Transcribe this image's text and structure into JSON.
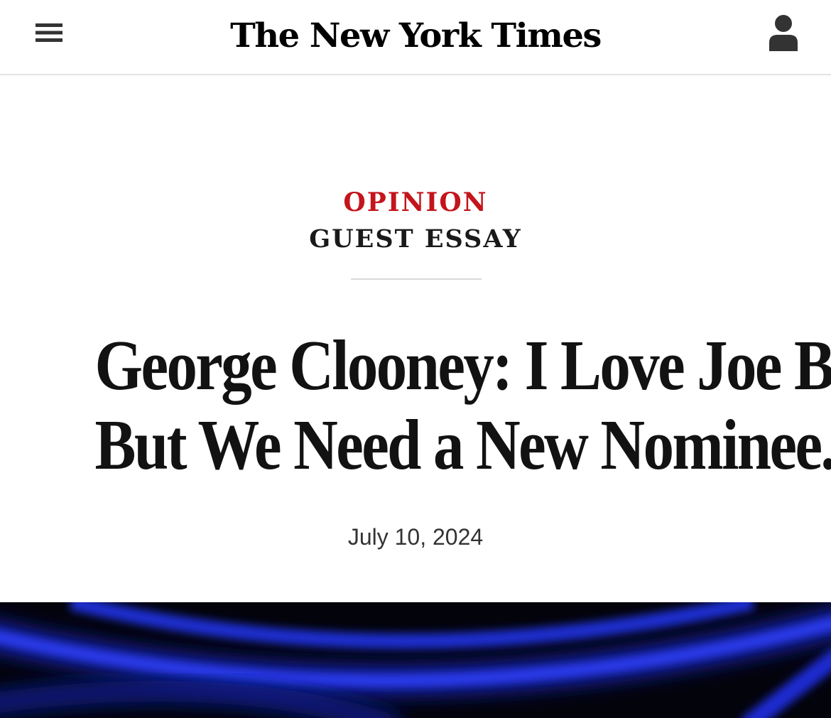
{
  "header": {
    "logo_text": "The New York Times",
    "menu_icon": "hamburger-menu-icon",
    "account_icon": "user-account-icon"
  },
  "article": {
    "kicker": "OPINION",
    "subkicker": "GUEST ESSAY",
    "headline_line1": "George Clooney: I Love Joe Biden.",
    "headline_line2": "But We Need a New Nominee.",
    "date": "July 10, 2024"
  },
  "colors": {
    "kicker": "#c4141c",
    "text": "#121212",
    "image_glow": "#1a2fd6"
  }
}
